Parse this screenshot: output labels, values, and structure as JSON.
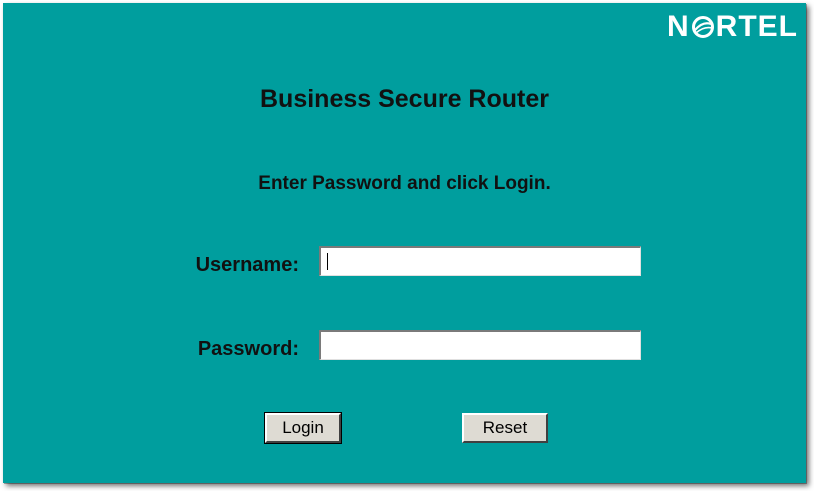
{
  "brand": {
    "logo_pre": "N",
    "logo_post": "RTEL"
  },
  "page": {
    "title": "Business Secure Router",
    "instruction": "Enter Password and click Login."
  },
  "form": {
    "username_label": "Username:",
    "username_value": "",
    "password_label": "Password:",
    "password_value": ""
  },
  "buttons": {
    "login_label": "Login",
    "reset_label": "Reset"
  },
  "colors": {
    "background": "#009e9e",
    "text": "#111111",
    "button_face": "#dedbd3"
  }
}
